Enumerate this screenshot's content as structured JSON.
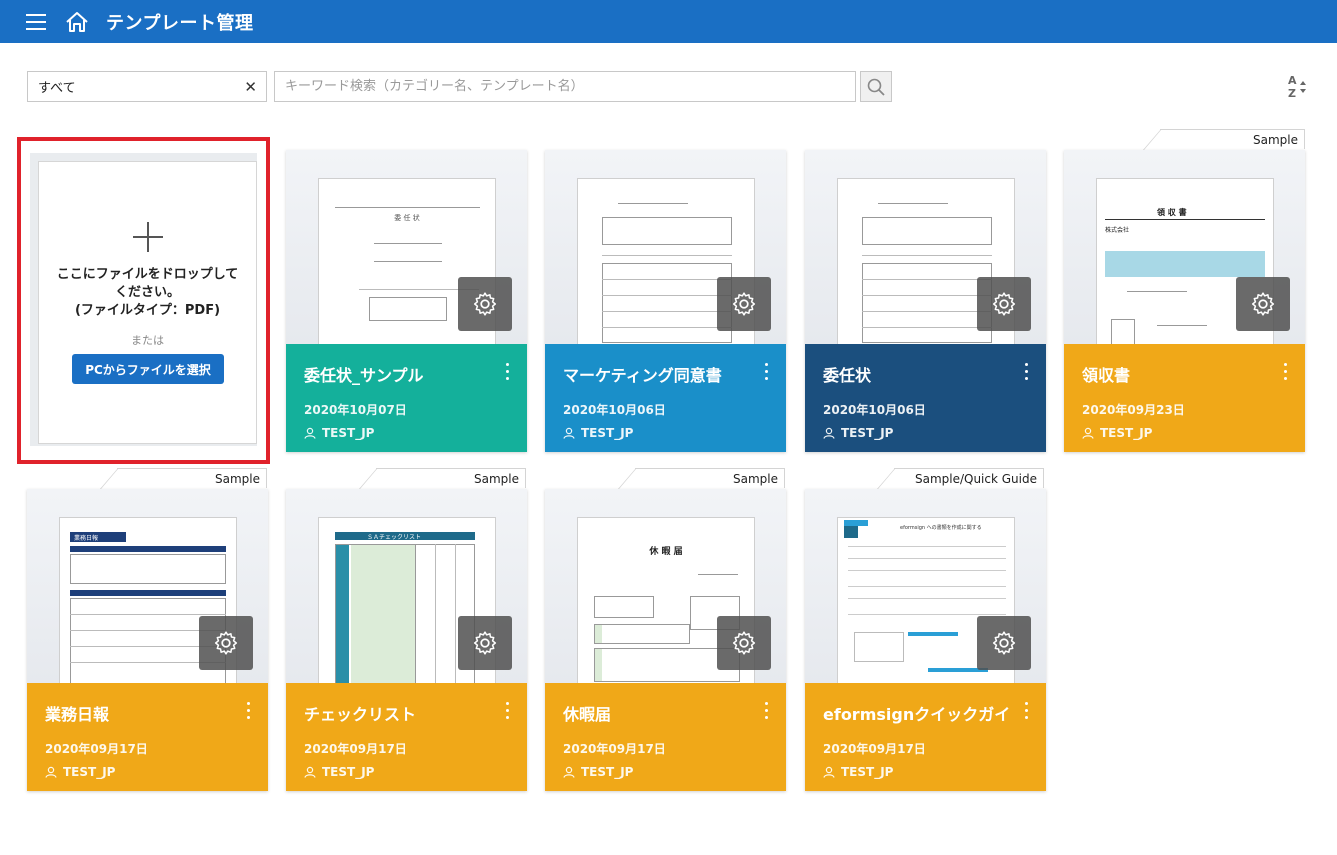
{
  "header": {
    "title": "テンプレート管理"
  },
  "filter": {
    "category_value": "すべて",
    "clear_symbol": "✕",
    "search_placeholder": "キーワード検索（カテゴリー名、テンプレート名）"
  },
  "upload": {
    "drop_line1": "ここにファイルをドロップして",
    "drop_line2": "ください。",
    "drop_line3": "(ファイルタイプ：PDF)",
    "or": "または",
    "select_button": "PCからファイルを選択"
  },
  "templates": [
    {
      "name": "委任状_サンプル",
      "date": "2020年10月07日",
      "owner": "TEST_JP",
      "color": "#14b09b",
      "tag": ""
    },
    {
      "name": "マーケティング同意書",
      "date": "2020年10月06日",
      "owner": "TEST_JP",
      "color": "#1a8fc9",
      "tag": ""
    },
    {
      "name": "委任状",
      "date": "2020年10月06日",
      "owner": "TEST_JP",
      "color": "#1b4f7e",
      "tag": ""
    },
    {
      "name": "領収書",
      "date": "2020年09月23日",
      "owner": "TEST_JP",
      "color": "#f0a818",
      "tag": "Sample"
    },
    {
      "name": "業務日報",
      "date": "2020年09月17日",
      "owner": "TEST_JP",
      "color": "#f0a818",
      "tag": "Sample"
    },
    {
      "name": "チェックリスト",
      "date": "2020年09月17日",
      "owner": "TEST_JP",
      "color": "#f0a818",
      "tag": "Sample"
    },
    {
      "name": "休暇届",
      "date": "2020年09月17日",
      "owner": "TEST_JP",
      "color": "#f0a818",
      "tag": "Sample"
    },
    {
      "name": "eformsignクイックガイド",
      "date": "2020年09月17日",
      "owner": "TEST_JP",
      "color": "#f0a818",
      "tag": "Sample/Quick Guide"
    }
  ],
  "thumbnails": {
    "doc1_title": "委 任 状",
    "doc4_title": "領 収 書",
    "doc4_label": "株式会社",
    "doc4_amount": "¥",
    "doc5_title": "業務日報",
    "doc6_title": "ＳＡチェックリスト",
    "doc7_title": "休 暇 届",
    "doc8_title": "eformsign への書類を作成に関する"
  }
}
